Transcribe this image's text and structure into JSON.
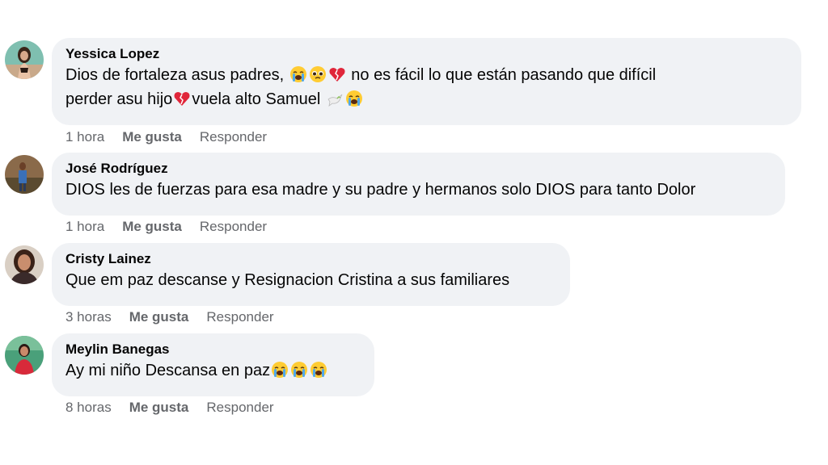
{
  "comments": [
    {
      "author": "Yessica Lopez",
      "text_1": "Dios de fortaleza asus padres, ",
      "text_2": " no es fácil lo que están pasando que difícil",
      "text_3": "perder asu hijo",
      "text_4": "vuela alto Samuel ",
      "time": "1 hora",
      "like": "Me gusta",
      "reply": "Responder"
    },
    {
      "author": "José Rodríguez",
      "text": "DIOS les de fuerzas para esa madre y su padre y hermanos solo DIOS para tanto Dolor",
      "time": "1 hora",
      "like": "Me gusta",
      "reply": "Responder"
    },
    {
      "author": "Cristy Lainez",
      "text": "Que em paz descanse y Resignacion Cristina a sus familiares",
      "time": "3 horas",
      "like": "Me gusta",
      "reply": "Responder"
    },
    {
      "author": "Meylin Banegas",
      "text": "Ay mi niño Descansa en paz",
      "time": "8 horas",
      "like": "Me gusta",
      "reply": "Responder"
    }
  ],
  "colors": {
    "bubble": "#f0f2f5",
    "text": "#050505",
    "secondary": "#65676b"
  },
  "icons": [
    "loudly-crying-face-emoji",
    "pleading-face-emoji",
    "broken-heart-emoji",
    "dove-emoji"
  ]
}
